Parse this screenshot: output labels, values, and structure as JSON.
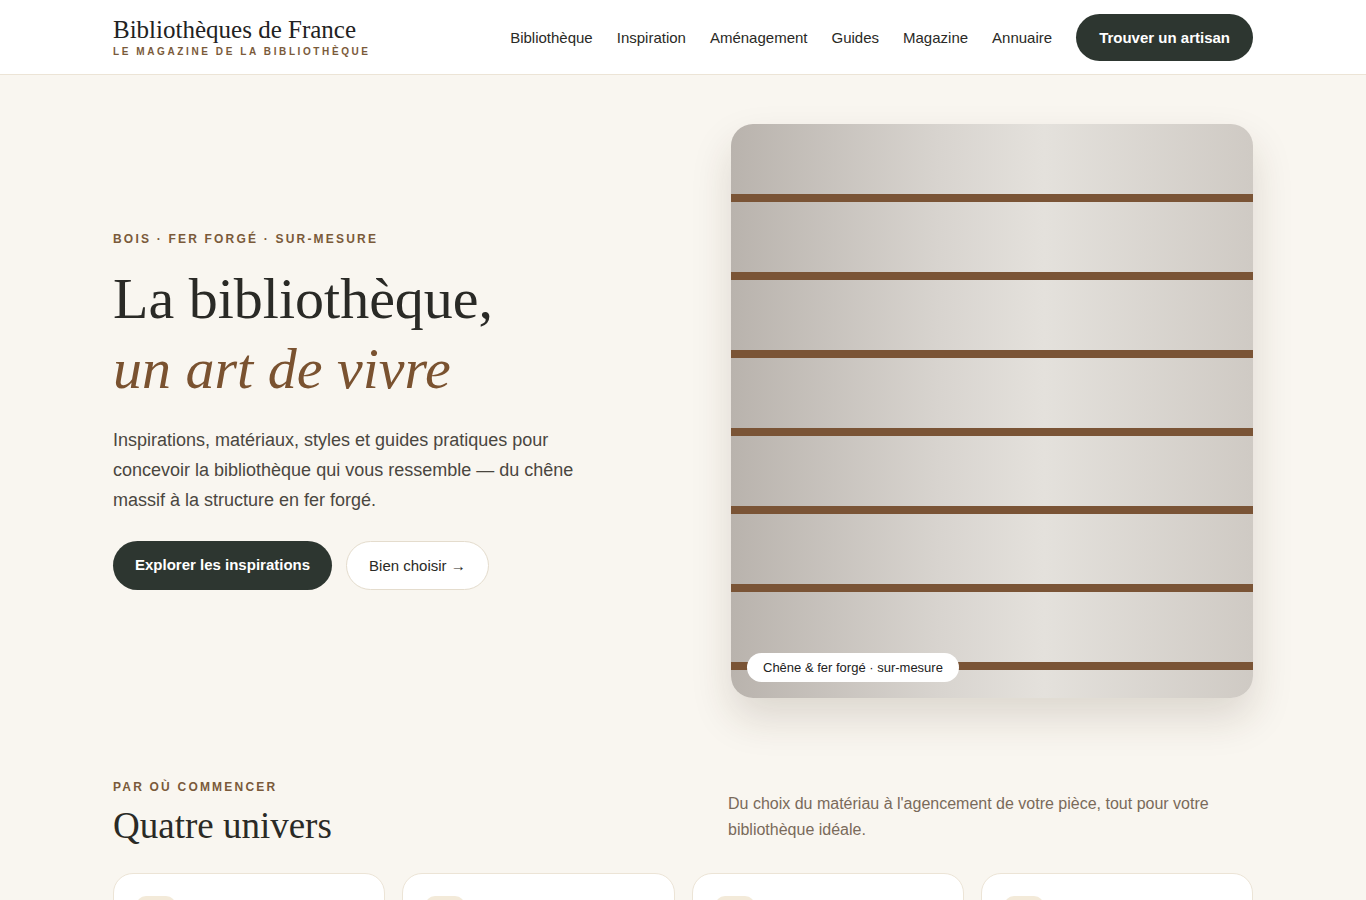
{
  "header": {
    "logo": {
      "title": "Bibliothèques de France",
      "subtitle": "LE MAGAZINE DE LA BIBLIOTHÈQUE"
    },
    "nav": [
      "Bibliothèque",
      "Inspiration",
      "Aménagement",
      "Guides",
      "Magazine",
      "Annuaire"
    ],
    "cta": "Trouver un artisan"
  },
  "hero": {
    "eyebrow": "BOIS · FER FORGÉ · SUR-MESURE",
    "title": "La bibliothèque,",
    "title_accent": "un art de vivre",
    "text": "Inspirations, matériaux, styles et guides pratiques pour concevoir la bibliothèque qui vous ressemble — du chêne massif à la structure en fer forgé.",
    "buttons": [
      {
        "label": "Explorer les inspirations",
        "kind": "primary"
      },
      {
        "label": "Bien choisir →",
        "kind": "secondary"
      }
    ],
    "image_badge": "Chêne & fer forgé · sur-mesure"
  },
  "section": {
    "eyebrow": "PAR OÙ COMMENCER",
    "title": "Quatre univers",
    "text": "Du choix du matériau à l'agencement de votre pièce, tout pour votre bibliothèque idéale."
  }
}
